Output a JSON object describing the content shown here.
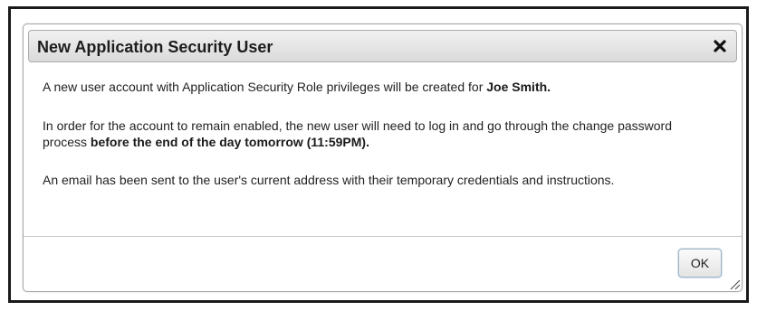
{
  "dialog": {
    "title": "New Application Security User",
    "close_icon": "close-icon",
    "paragraph1": {
      "text": "A new user account with Application Security Role privileges will be created for ",
      "bold": "Joe Smith."
    },
    "paragraph2": {
      "text": "In order for the account to remain enabled, the new user will need to log in and go through the change password process ",
      "bold": "before the end of the day tomorrow (11:59PM)."
    },
    "paragraph3": {
      "text": "An email has been sent to the user's current address with their temporary credentials and instructions."
    },
    "ok_label": "OK",
    "resize_icon": "resize-grip-icon"
  },
  "colors": {
    "frame_border": "#1a1a1a",
    "titlebar_top": "#f1f1f1",
    "titlebar_bottom": "#dadada",
    "text": "#222222"
  }
}
